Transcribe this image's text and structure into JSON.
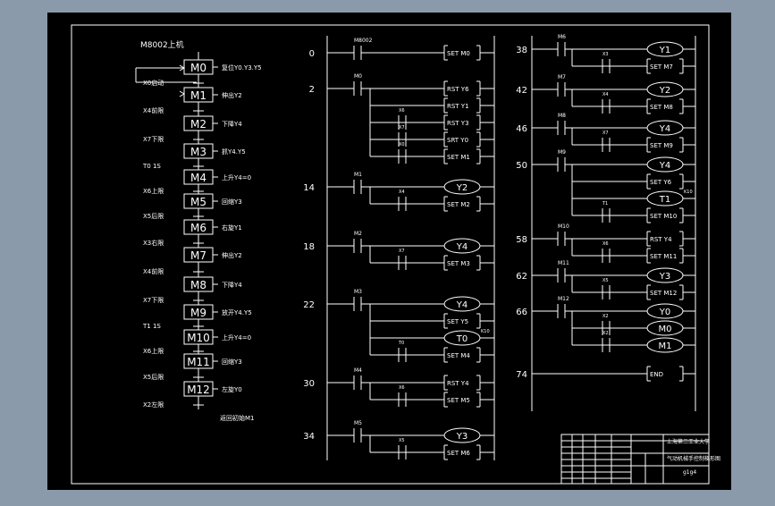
{
  "theme": {
    "bg": "#8a9aab",
    "sheet": "#000000",
    "ink": "#ffffff"
  },
  "sfc": {
    "title": "M8002上机",
    "steps": [
      {
        "box": "M0",
        "action": "复位Y0.Y3.Y5",
        "trans": "X0启动"
      },
      {
        "box": "M1",
        "action": "伸出Y2",
        "trans": "X4前限"
      },
      {
        "box": "M2",
        "action": "下降Y4",
        "trans": "X7下限"
      },
      {
        "box": "M3",
        "action": "抓Y4.Y5",
        "trans": "T0  1S"
      },
      {
        "box": "M4",
        "action": "上升Y4=0",
        "trans": "X6上限"
      },
      {
        "box": "M5",
        "action": "回缩Y3",
        "trans": "X5后限"
      },
      {
        "box": "M6",
        "action": "右旋Y1",
        "trans": "X3右限"
      },
      {
        "box": "M7",
        "action": "伸出Y2",
        "trans": "X4前限"
      },
      {
        "box": "M8",
        "action": "下降Y4",
        "trans": "X7下限"
      },
      {
        "box": "M9",
        "action": "放开Y4.Y5",
        "trans": "T1  1S"
      },
      {
        "box": "M10",
        "action": "上升Y4=0",
        "trans": "X6上限"
      },
      {
        "box": "M11",
        "action": "回缩Y3",
        "trans": "X5后限"
      },
      {
        "box": "M12",
        "action": "左旋Y0",
        "trans": "X2左限"
      }
    ],
    "end": "返回初始M1"
  },
  "ladder1": {
    "rungs": [
      {
        "num": "0",
        "contact": "M8002",
        "outs": [
          {
            "k": "c",
            "t": "SET  M0"
          }
        ],
        "br": []
      },
      {
        "num": "2",
        "contact": "M0",
        "outs": [
          {
            "k": "c",
            "t": "RST  Y6"
          },
          {
            "k": "c",
            "t": "RST  Y1"
          },
          {
            "k": "c",
            "t": "RST  Y3"
          },
          {
            "k": "c",
            "t": "SRT  Y0"
          },
          {
            "k": "c",
            "t": "SET  M1"
          }
        ],
        "br": [
          {
            "row": 2,
            "lbl": "X6"
          },
          {
            "row": 3,
            "lbl": "X7"
          },
          {
            "row": 4,
            "lbl": "X0"
          }
        ]
      },
      {
        "num": "14",
        "contact": "M1",
        "outs": [
          {
            "k": "o",
            "t": "Y2"
          },
          {
            "k": "c",
            "t": "SET  M2"
          }
        ],
        "br": [
          {
            "row": 1,
            "lbl": "X4"
          }
        ]
      },
      {
        "num": "18",
        "contact": "M2",
        "outs": [
          {
            "k": "o",
            "t": "Y4"
          },
          {
            "k": "c",
            "t": "SET  M3"
          }
        ],
        "br": [
          {
            "row": 1,
            "lbl": "X7"
          }
        ]
      },
      {
        "num": "22",
        "contact": "M3",
        "outs": [
          {
            "k": "o",
            "t": "Y4"
          },
          {
            "k": "c",
            "t": "SET  Y5"
          },
          {
            "k": "o",
            "t": "T0",
            "sub": "K10"
          },
          {
            "k": "c",
            "t": "SET  M4"
          }
        ],
        "br": [
          {
            "row": 3,
            "lbl": "T0"
          }
        ]
      },
      {
        "num": "30",
        "contact": "M4",
        "outs": [
          {
            "k": "c",
            "t": "RST  Y4"
          },
          {
            "k": "c",
            "t": "SET  M5"
          }
        ],
        "br": [
          {
            "row": 1,
            "lbl": "X6"
          }
        ]
      },
      {
        "num": "34",
        "contact": "M5",
        "outs": [
          {
            "k": "o",
            "t": "Y3"
          },
          {
            "k": "c",
            "t": "SET  M6"
          }
        ],
        "br": [
          {
            "row": 1,
            "lbl": "X5"
          }
        ]
      }
    ]
  },
  "ladder2": {
    "rungs": [
      {
        "num": "38",
        "contact": "M6",
        "outs": [
          {
            "k": "o",
            "t": "Y1"
          },
          {
            "k": "c",
            "t": "SET  M7"
          }
        ],
        "br": [
          {
            "row": 1,
            "lbl": "X3"
          }
        ]
      },
      {
        "num": "42",
        "contact": "M7",
        "outs": [
          {
            "k": "o",
            "t": "Y2"
          },
          {
            "k": "c",
            "t": "SET  M8"
          }
        ],
        "br": [
          {
            "row": 1,
            "lbl": "X4"
          }
        ]
      },
      {
        "num": "46",
        "contact": "M8",
        "outs": [
          {
            "k": "o",
            "t": "Y4"
          },
          {
            "k": "c",
            "t": "SET  M9"
          }
        ],
        "br": [
          {
            "row": 1,
            "lbl": "X7"
          }
        ]
      },
      {
        "num": "50",
        "contact": "M9",
        "outs": [
          {
            "k": "o",
            "t": "Y4"
          },
          {
            "k": "c",
            "t": "SET  Y6"
          },
          {
            "k": "o",
            "t": "T1",
            "sub": "K10"
          },
          {
            "k": "c",
            "t": "SET  M10"
          }
        ],
        "br": [
          {
            "row": 3,
            "lbl": "T1"
          }
        ]
      },
      {
        "num": "58",
        "contact": "M10",
        "outs": [
          {
            "k": "c",
            "t": "RST  Y4"
          },
          {
            "k": "c",
            "t": "SET  M11"
          }
        ],
        "br": [
          {
            "row": 1,
            "lbl": "X6"
          }
        ]
      },
      {
        "num": "62",
        "contact": "M11",
        "outs": [
          {
            "k": "o",
            "t": "Y3"
          },
          {
            "k": "c",
            "t": "SET  M12"
          }
        ],
        "br": [
          {
            "row": 1,
            "lbl": "X5"
          }
        ]
      },
      {
        "num": "66",
        "contact": "M12",
        "outs": [
          {
            "k": "o",
            "t": "Y0"
          },
          {
            "k": "o",
            "t": "M0"
          },
          {
            "k": "o",
            "t": "M1"
          }
        ],
        "br": [
          {
            "row": 1,
            "lbl": "X2"
          },
          {
            "row": 2,
            "lbl": "X2"
          }
        ]
      },
      {
        "num": "74",
        "contact": "",
        "outs": [
          {
            "k": "c",
            "t": "END"
          }
        ],
        "br": []
      }
    ]
  },
  "titleblock": {
    "school": "上海第二工业大学",
    "drawing": "气动机械手控制梯形图",
    "code": "g1g4"
  }
}
